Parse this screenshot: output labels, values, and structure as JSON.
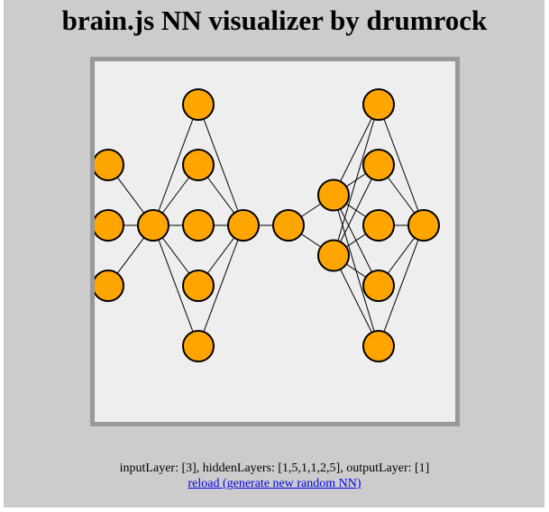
{
  "page": {
    "title": "brain.js NN visualizer by drumrock"
  },
  "info": {
    "layers_text": "inputLayer: [3], hiddenLayers: [1,5,1,1,2,5], outputLayer: [1]",
    "reload_link": "reload (generate new random NN)"
  },
  "network": {
    "input_layer": 3,
    "hidden_layers": [
      1,
      5,
      1,
      1,
      2,
      5
    ],
    "output_layer": 1
  },
  "colors": {
    "background": "#cccccc",
    "canvas_background": "#eeeeee",
    "canvas_border": "#999999",
    "node_fill": "#ffa500",
    "node_stroke": "#000000",
    "link_color": "#0000ee"
  }
}
